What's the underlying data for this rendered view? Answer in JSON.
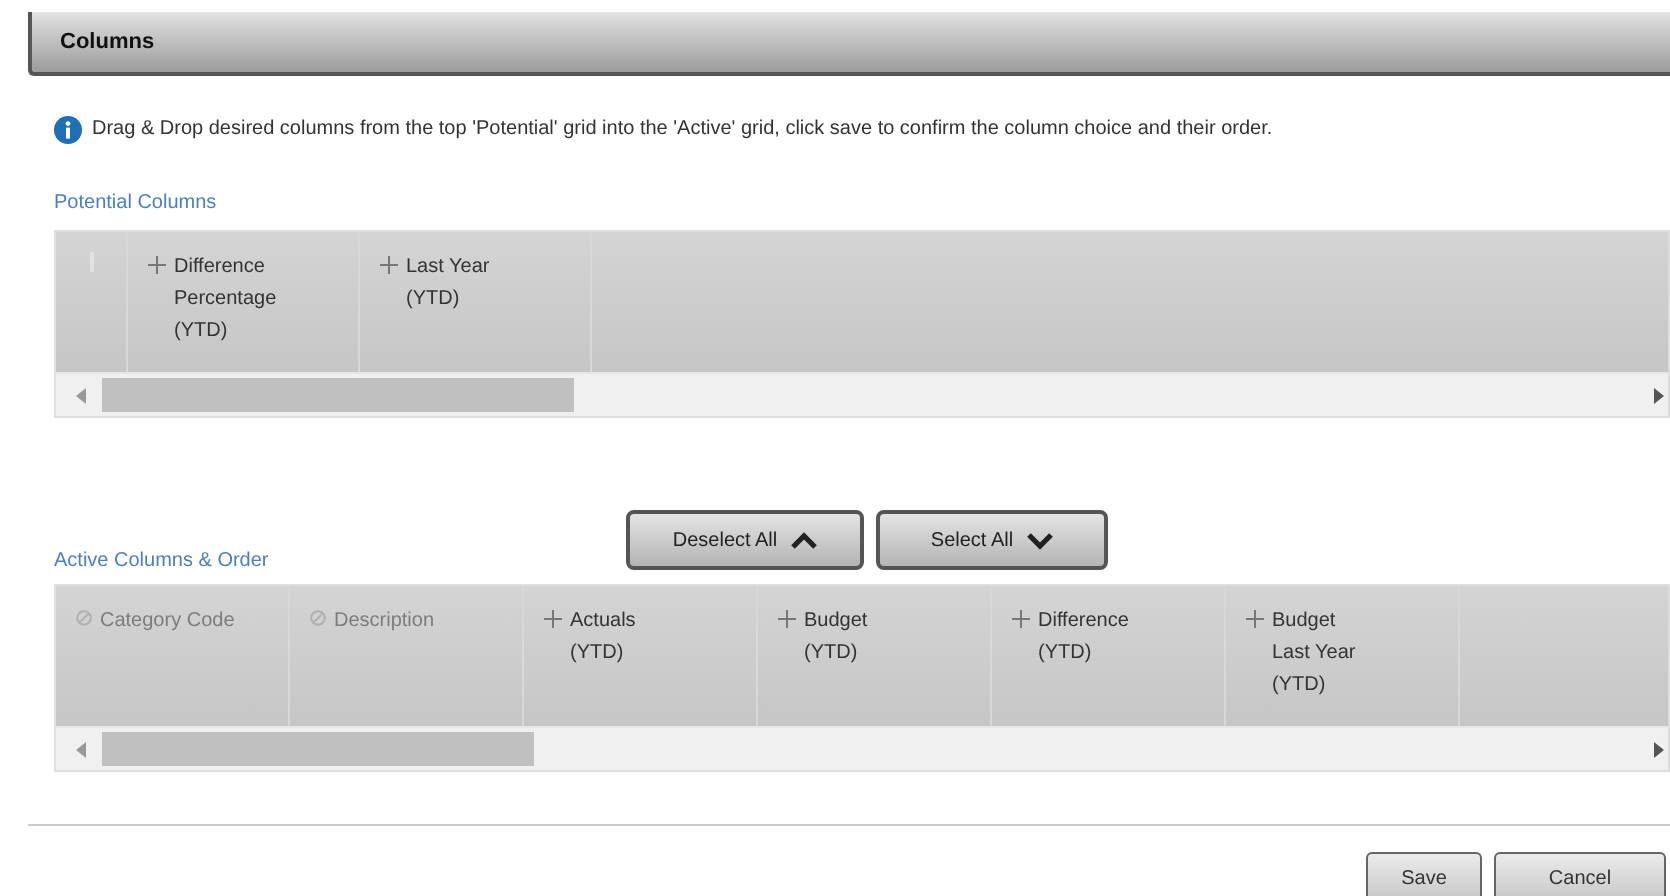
{
  "window": {
    "title": "Columns"
  },
  "info": "Drag & Drop desired columns from the top 'Potential' grid into the 'Active' grid, click save to confirm the column choice and their order.",
  "potential": {
    "label": "Potential Columns",
    "columns": [
      {
        "lines": [
          "Difference",
          "Percentage",
          "(YTD)"
        ],
        "disabled": false
      },
      {
        "lines": [
          "Last Year",
          "(YTD)"
        ],
        "disabled": false
      }
    ]
  },
  "buttons": [
    "Deselect All",
    "Select All"
  ],
  "active": {
    "label": "Active Columns & Order",
    "columns": [
      {
        "lines": [
          "Category Code"
        ],
        "disabled": true
      },
      {
        "lines": [
          "Description"
        ],
        "disabled": true
      },
      {
        "lines": [
          "Actuals",
          "(YTD)"
        ],
        "disabled": false
      },
      {
        "lines": [
          "Budget",
          "(YTD)"
        ],
        "disabled": false
      },
      {
        "lines": [
          "Difference",
          "(YTD)"
        ],
        "disabled": false
      },
      {
        "lines": [
          "Budget",
          "Last Year",
          "(YTD)"
        ],
        "disabled": false
      }
    ]
  },
  "footer_buttons": [
    "Save",
    "Cancel"
  ]
}
